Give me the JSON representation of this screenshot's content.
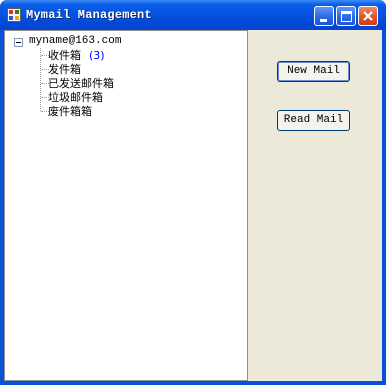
{
  "window": {
    "title": "Mymail Management",
    "colors": {
      "title_bar": "#0551de",
      "client_bg": "#ece9d8",
      "close_button": "#d9522c"
    }
  },
  "titlebar_buttons": [
    {
      "name": "minimize-button",
      "icon": "minimize-icon"
    },
    {
      "name": "maximize-button",
      "icon": "maximize-icon"
    },
    {
      "name": "close-button",
      "icon": "close-icon"
    }
  ],
  "tree": {
    "root": {
      "label": "myname@163.com",
      "expanded": true
    },
    "children": [
      {
        "label": "收件箱",
        "count": "(3)"
      },
      {
        "label": "发件箱"
      },
      {
        "label": "已发送邮件箱"
      },
      {
        "label": "垃圾邮件箱"
      },
      {
        "label": "废件箱箱"
      }
    ]
  },
  "buttons": {
    "new_mail": "New Mail",
    "read_mail": "Read Mail"
  }
}
